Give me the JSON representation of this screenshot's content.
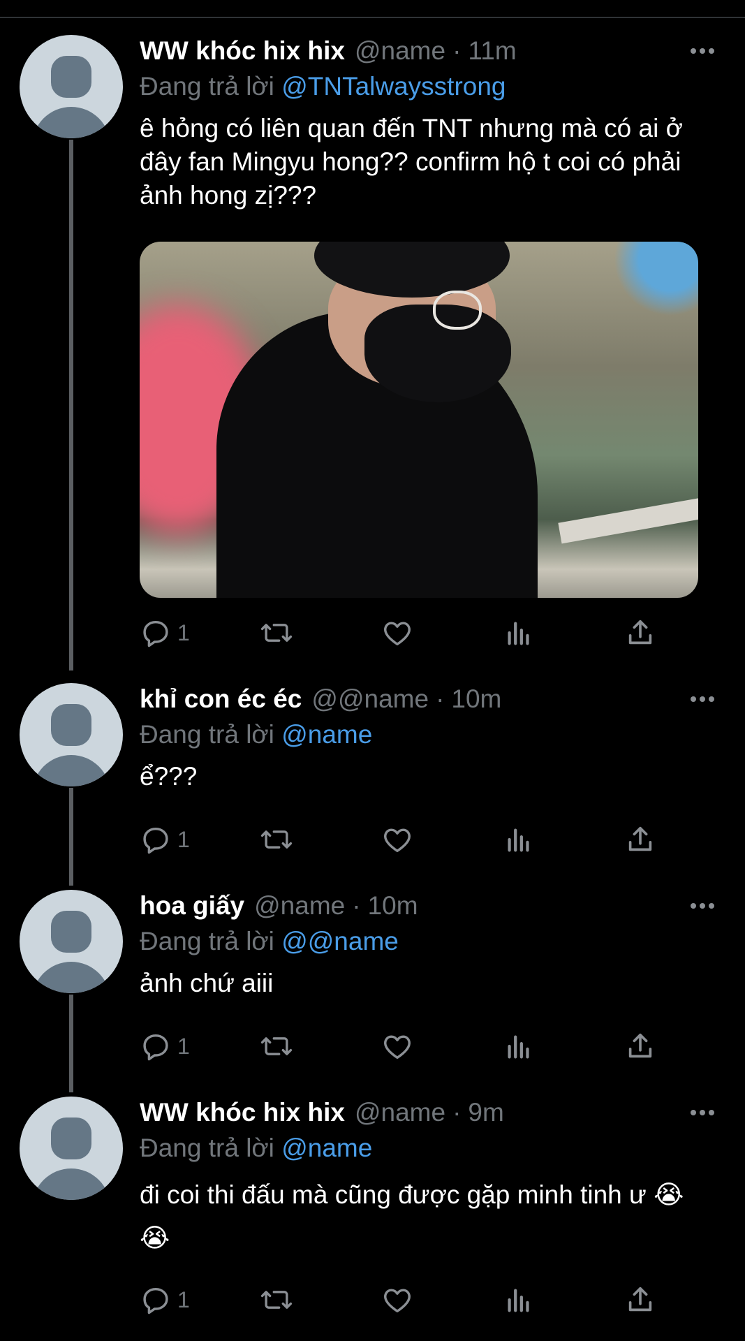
{
  "tweets": [
    {
      "display_name": "WW khóc hix hix",
      "handle": "@name",
      "time": "11m",
      "reply_prefix": "Đang trả lời",
      "reply_to": "@TNTalwaysstrong",
      "text": "ê hỏng có liên quan đến TNT nhưng mà có ai ở đây fan Mingyu hong?? confirm hộ t coi có phải ảnh hong zị???",
      "has_media": true,
      "reply_count": "1"
    },
    {
      "display_name": "khỉ con éc éc",
      "handle": "@@name",
      "time": "10m",
      "reply_prefix": "Đang trả lời",
      "reply_to": "@name",
      "text": "ể???",
      "has_media": false,
      "reply_count": "1"
    },
    {
      "display_name": "hoa giấy",
      "handle": "@name",
      "time": "10m",
      "reply_prefix": "Đang trả lời",
      "reply_to": "@@name",
      "text": "ảnh chứ aiii",
      "has_media": false,
      "reply_count": "1"
    },
    {
      "display_name": "WW khóc hix hix",
      "handle": "@name",
      "time": "9m",
      "reply_prefix": "Đang trả lời",
      "reply_to": "@name",
      "text": "đi coi thi đấu mà cũng được gặp minh tinh ư 😭 😭",
      "has_media": false,
      "reply_count": "1"
    }
  ],
  "separator": "·",
  "icons": {
    "reply": "reply-icon",
    "retweet": "retweet-icon",
    "like": "heart-icon",
    "views": "analytics-icon",
    "share": "share-icon",
    "more": "more-icon"
  },
  "colors": {
    "background": "#000000",
    "primary_text": "#ffffff",
    "secondary_text": "#71767b",
    "link": "#4a9de8",
    "thread_line": "#5b5e62",
    "avatar_bg": "#ccd6dd",
    "avatar_fg": "#657786"
  }
}
